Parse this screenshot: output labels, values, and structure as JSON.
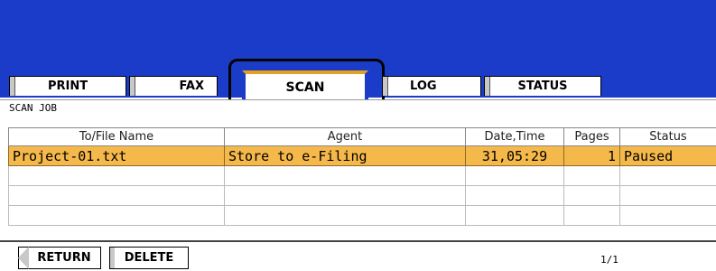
{
  "tabs": {
    "print": "PRINT",
    "fax": "FAX",
    "scan": "SCAN",
    "log": "LOG",
    "status": "STATUS"
  },
  "section_title": "SCAN JOB",
  "table": {
    "headers": [
      "To/File Name",
      "Agent",
      "Date,Time",
      "Pages",
      "Status"
    ],
    "rows": [
      [
        "Project-01.txt",
        "Store to e-Filing",
        "31,05:29",
        "1",
        "Paused"
      ],
      [
        "",
        "",
        "",
        "",
        ""
      ],
      [
        "",
        "",
        "",
        "",
        ""
      ],
      [
        "",
        "",
        "",
        "",
        ""
      ]
    ]
  },
  "buttons": {
    "return": "RETURN",
    "delete": "DELETE"
  },
  "page_indicator": "1/1",
  "colors": {
    "header_blue": "#1a3cc8",
    "selected_row": "#f5b84a",
    "tab_accent": "#e6a020"
  }
}
